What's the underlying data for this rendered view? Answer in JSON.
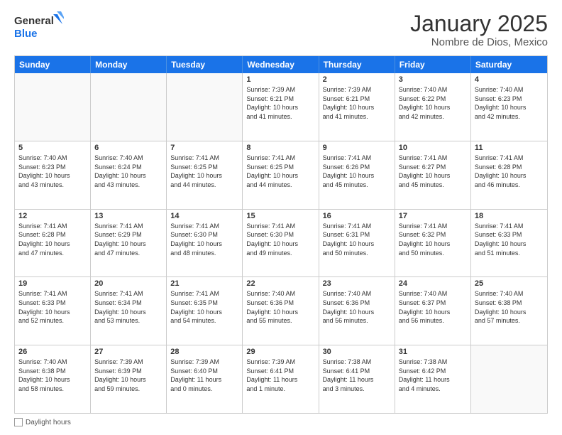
{
  "logo": {
    "line1": "General",
    "line2": "Blue"
  },
  "header": {
    "month": "January 2025",
    "location": "Nombre de Dios, Mexico"
  },
  "days": [
    "Sunday",
    "Monday",
    "Tuesday",
    "Wednesday",
    "Thursday",
    "Friday",
    "Saturday"
  ],
  "weeks": [
    [
      {
        "day": "",
        "info": ""
      },
      {
        "day": "",
        "info": ""
      },
      {
        "day": "",
        "info": ""
      },
      {
        "day": "1",
        "info": "Sunrise: 7:39 AM\nSunset: 6:21 PM\nDaylight: 10 hours\nand 41 minutes."
      },
      {
        "day": "2",
        "info": "Sunrise: 7:39 AM\nSunset: 6:21 PM\nDaylight: 10 hours\nand 41 minutes."
      },
      {
        "day": "3",
        "info": "Sunrise: 7:40 AM\nSunset: 6:22 PM\nDaylight: 10 hours\nand 42 minutes."
      },
      {
        "day": "4",
        "info": "Sunrise: 7:40 AM\nSunset: 6:23 PM\nDaylight: 10 hours\nand 42 minutes."
      }
    ],
    [
      {
        "day": "5",
        "info": "Sunrise: 7:40 AM\nSunset: 6:23 PM\nDaylight: 10 hours\nand 43 minutes."
      },
      {
        "day": "6",
        "info": "Sunrise: 7:40 AM\nSunset: 6:24 PM\nDaylight: 10 hours\nand 43 minutes."
      },
      {
        "day": "7",
        "info": "Sunrise: 7:41 AM\nSunset: 6:25 PM\nDaylight: 10 hours\nand 44 minutes."
      },
      {
        "day": "8",
        "info": "Sunrise: 7:41 AM\nSunset: 6:25 PM\nDaylight: 10 hours\nand 44 minutes."
      },
      {
        "day": "9",
        "info": "Sunrise: 7:41 AM\nSunset: 6:26 PM\nDaylight: 10 hours\nand 45 minutes."
      },
      {
        "day": "10",
        "info": "Sunrise: 7:41 AM\nSunset: 6:27 PM\nDaylight: 10 hours\nand 45 minutes."
      },
      {
        "day": "11",
        "info": "Sunrise: 7:41 AM\nSunset: 6:28 PM\nDaylight: 10 hours\nand 46 minutes."
      }
    ],
    [
      {
        "day": "12",
        "info": "Sunrise: 7:41 AM\nSunset: 6:28 PM\nDaylight: 10 hours\nand 47 minutes."
      },
      {
        "day": "13",
        "info": "Sunrise: 7:41 AM\nSunset: 6:29 PM\nDaylight: 10 hours\nand 47 minutes."
      },
      {
        "day": "14",
        "info": "Sunrise: 7:41 AM\nSunset: 6:30 PM\nDaylight: 10 hours\nand 48 minutes."
      },
      {
        "day": "15",
        "info": "Sunrise: 7:41 AM\nSunset: 6:30 PM\nDaylight: 10 hours\nand 49 minutes."
      },
      {
        "day": "16",
        "info": "Sunrise: 7:41 AM\nSunset: 6:31 PM\nDaylight: 10 hours\nand 50 minutes."
      },
      {
        "day": "17",
        "info": "Sunrise: 7:41 AM\nSunset: 6:32 PM\nDaylight: 10 hours\nand 50 minutes."
      },
      {
        "day": "18",
        "info": "Sunrise: 7:41 AM\nSunset: 6:33 PM\nDaylight: 10 hours\nand 51 minutes."
      }
    ],
    [
      {
        "day": "19",
        "info": "Sunrise: 7:41 AM\nSunset: 6:33 PM\nDaylight: 10 hours\nand 52 minutes."
      },
      {
        "day": "20",
        "info": "Sunrise: 7:41 AM\nSunset: 6:34 PM\nDaylight: 10 hours\nand 53 minutes."
      },
      {
        "day": "21",
        "info": "Sunrise: 7:41 AM\nSunset: 6:35 PM\nDaylight: 10 hours\nand 54 minutes."
      },
      {
        "day": "22",
        "info": "Sunrise: 7:40 AM\nSunset: 6:36 PM\nDaylight: 10 hours\nand 55 minutes."
      },
      {
        "day": "23",
        "info": "Sunrise: 7:40 AM\nSunset: 6:36 PM\nDaylight: 10 hours\nand 56 minutes."
      },
      {
        "day": "24",
        "info": "Sunrise: 7:40 AM\nSunset: 6:37 PM\nDaylight: 10 hours\nand 56 minutes."
      },
      {
        "day": "25",
        "info": "Sunrise: 7:40 AM\nSunset: 6:38 PM\nDaylight: 10 hours\nand 57 minutes."
      }
    ],
    [
      {
        "day": "26",
        "info": "Sunrise: 7:40 AM\nSunset: 6:38 PM\nDaylight: 10 hours\nand 58 minutes."
      },
      {
        "day": "27",
        "info": "Sunrise: 7:39 AM\nSunset: 6:39 PM\nDaylight: 10 hours\nand 59 minutes."
      },
      {
        "day": "28",
        "info": "Sunrise: 7:39 AM\nSunset: 6:40 PM\nDaylight: 11 hours\nand 0 minutes."
      },
      {
        "day": "29",
        "info": "Sunrise: 7:39 AM\nSunset: 6:41 PM\nDaylight: 11 hours\nand 1 minute."
      },
      {
        "day": "30",
        "info": "Sunrise: 7:38 AM\nSunset: 6:41 PM\nDaylight: 11 hours\nand 3 minutes."
      },
      {
        "day": "31",
        "info": "Sunrise: 7:38 AM\nSunset: 6:42 PM\nDaylight: 11 hours\nand 4 minutes."
      },
      {
        "day": "",
        "info": ""
      }
    ]
  ],
  "footer": {
    "label": "Daylight hours"
  }
}
